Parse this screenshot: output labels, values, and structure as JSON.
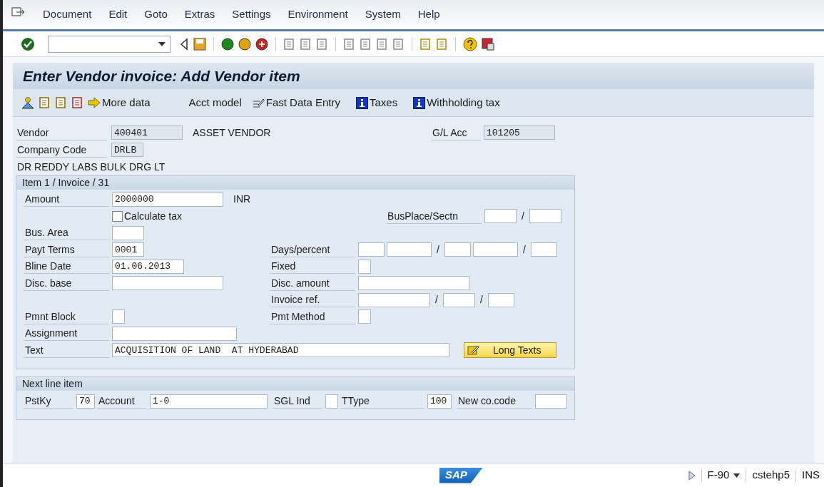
{
  "menu": [
    {
      "label": "Document"
    },
    {
      "label": "Edit"
    },
    {
      "label": "Goto"
    },
    {
      "label": "Extras"
    },
    {
      "label": "Settings"
    },
    {
      "label": "Environment"
    },
    {
      "label": "System"
    },
    {
      "label": "Help"
    }
  ],
  "title": "Enter Vendor invoice: Add Vendor item",
  "app_toolbar": [
    {
      "label": "More data",
      "kind": "arrow"
    },
    {
      "label": "Acct model",
      "kind": "plain"
    },
    {
      "label": "Fast Data Entry",
      "kind": "pen"
    },
    {
      "label": "Taxes",
      "kind": "info"
    },
    {
      "label": "Withholding tax",
      "kind": "info"
    }
  ],
  "header": {
    "vendor": {
      "label": "Vendor",
      "value": "400401",
      "name": "ASSET VENDOR"
    },
    "gl_acc": {
      "label": "G/L Acc",
      "value": "101205"
    },
    "company_code": {
      "label": "Company Code",
      "value": "DRLB"
    },
    "company_name": "DR REDDY LABS BULK DRG LT"
  },
  "item": {
    "title": "Item 1 / Invoice / 31",
    "amount": {
      "label": "Amount",
      "inputs": [
        {
          "kind": "input",
          "value": "2000000"
        }
      ],
      "unit": "INR"
    },
    "calculate_tax": {
      "label": "Calculate tax",
      "checked": false
    },
    "bus_place": {
      "label": "BusPlace/Sectn",
      "inputs": [
        {
          "kind": "input"
        },
        {
          "kind": "sep",
          "text": "/"
        },
        {
          "kind": "input"
        }
      ]
    },
    "bus_area": {
      "label": "Bus. Area",
      "inputs": [
        {
          "kind": "input"
        }
      ]
    },
    "payt_terms": {
      "label": "Payt Terms",
      "inputs": [
        {
          "kind": "input",
          "value": "0001"
        }
      ]
    },
    "days_percent": {
      "label": "Days/percent",
      "inputs": [
        {
          "kind": "input"
        },
        {
          "kind": "input"
        },
        {
          "kind": "sep",
          "text": "/"
        },
        {
          "kind": "input"
        },
        {
          "kind": "input"
        },
        {
          "kind": "sep",
          "text": "/"
        },
        {
          "kind": "input"
        }
      ]
    },
    "bline_date": {
      "label": "Bline Date",
      "inputs": [
        {
          "kind": "input",
          "value": "01.06.2013"
        }
      ]
    },
    "fixed": {
      "label": "Fixed",
      "inputs": [
        {
          "kind": "input"
        }
      ]
    },
    "disc_base": {
      "label": "Disc. base",
      "inputs": [
        {
          "kind": "input"
        }
      ]
    },
    "disc_amount": {
      "label": "Disc. amount",
      "inputs": [
        {
          "kind": "input"
        }
      ]
    },
    "invoice_ref": {
      "label": "Invoice ref.",
      "inputs": [
        {
          "kind": "input"
        },
        {
          "kind": "sep",
          "text": "/"
        },
        {
          "kind": "input"
        },
        {
          "kind": "sep",
          "text": "/"
        },
        {
          "kind": "input"
        }
      ]
    },
    "pmnt_block": {
      "label": "Pmnt Block",
      "inputs": [
        {
          "kind": "input"
        }
      ]
    },
    "pmt_method": {
      "label": "Pmt Method",
      "inputs": [
        {
          "kind": "input"
        }
      ]
    },
    "assignment": {
      "label": "Assignment",
      "inputs": [
        {
          "kind": "input"
        }
      ]
    },
    "text": {
      "label": "Text",
      "inputs": [
        {
          "kind": "input",
          "value": "ACQUISITION OF LAND  AT HYDERABAD"
        }
      ]
    },
    "long_texts_button": {
      "label": "Long Texts"
    }
  },
  "next_line_item": {
    "title": "Next line item",
    "pstky": {
      "label": "PstKy",
      "inputs": [
        {
          "kind": "input",
          "value": "70"
        }
      ]
    },
    "account": {
      "label": "Account",
      "inputs": [
        {
          "kind": "input",
          "value": "1-0"
        }
      ]
    },
    "sgl_ind": {
      "label": "SGL Ind",
      "inputs": [
        {
          "kind": "input"
        }
      ]
    },
    "ttype": {
      "label": "TType",
      "inputs": [
        {
          "kind": "input",
          "value": "100"
        }
      ]
    },
    "new_co_code": {
      "label": "New co.code",
      "inputs": [
        {
          "kind": "input"
        }
      ]
    }
  },
  "status_bar": {
    "logo": "SAP",
    "transaction": "F-90",
    "system": "cstehp5",
    "mode": "INS"
  }
}
